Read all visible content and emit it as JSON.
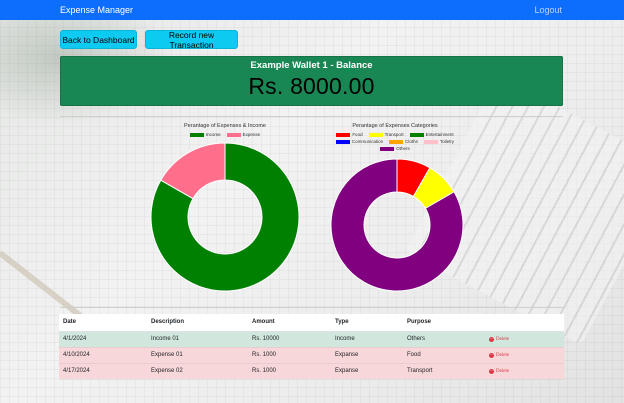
{
  "navbar": {
    "brand": "Expense Manager",
    "logout": "Logout"
  },
  "buttons": {
    "back": "Back to Dashboard",
    "record": "Record new Transaction"
  },
  "balance": {
    "title": "Example Wallet 1 - Balance",
    "amount": "Rs. 8000.00",
    "color": "#198754"
  },
  "chart_data": [
    {
      "type": "pie",
      "title": "Perantage of Expenses & Income",
      "categories": [
        "Income",
        "Expense"
      ],
      "values": [
        83.3,
        16.7
      ],
      "colors": [
        "#008000",
        "#ff6f8c"
      ],
      "legend": "top"
    },
    {
      "type": "pie",
      "title": "Perantage of Expenses Categories",
      "categories": [
        "Food",
        "Transport",
        "Entertainment",
        "Communication",
        "Cloths",
        "Toiletry",
        "Others"
      ],
      "values": [
        8.3,
        8.3,
        0,
        0,
        0,
        0,
        83.4
      ],
      "colors": [
        "#ff0000",
        "#ffff00",
        "#008000",
        "#0000ff",
        "#ffa500",
        "#ffc0cb",
        "#800080"
      ],
      "legend": "top"
    }
  ],
  "table": {
    "headers": [
      "Date",
      "Description",
      "Amount",
      "Type",
      "Purpose",
      ""
    ],
    "rows": [
      {
        "date": "4/1/2024",
        "description": "Income 01",
        "amount": "Rs. 10000",
        "type": "Income",
        "purpose": "Others",
        "action": "Delete",
        "kind": "income"
      },
      {
        "date": "4/10/2024",
        "description": "Expense 01",
        "amount": "Rs. 1000",
        "type": "Expanse",
        "purpose": "Food",
        "action": "Delete",
        "kind": "expense"
      },
      {
        "date": "4/17/2024",
        "description": "Expense 02",
        "amount": "Rs. 1000",
        "type": "Expanse",
        "purpose": "Transport",
        "action": "Delete",
        "kind": "expense"
      }
    ]
  }
}
